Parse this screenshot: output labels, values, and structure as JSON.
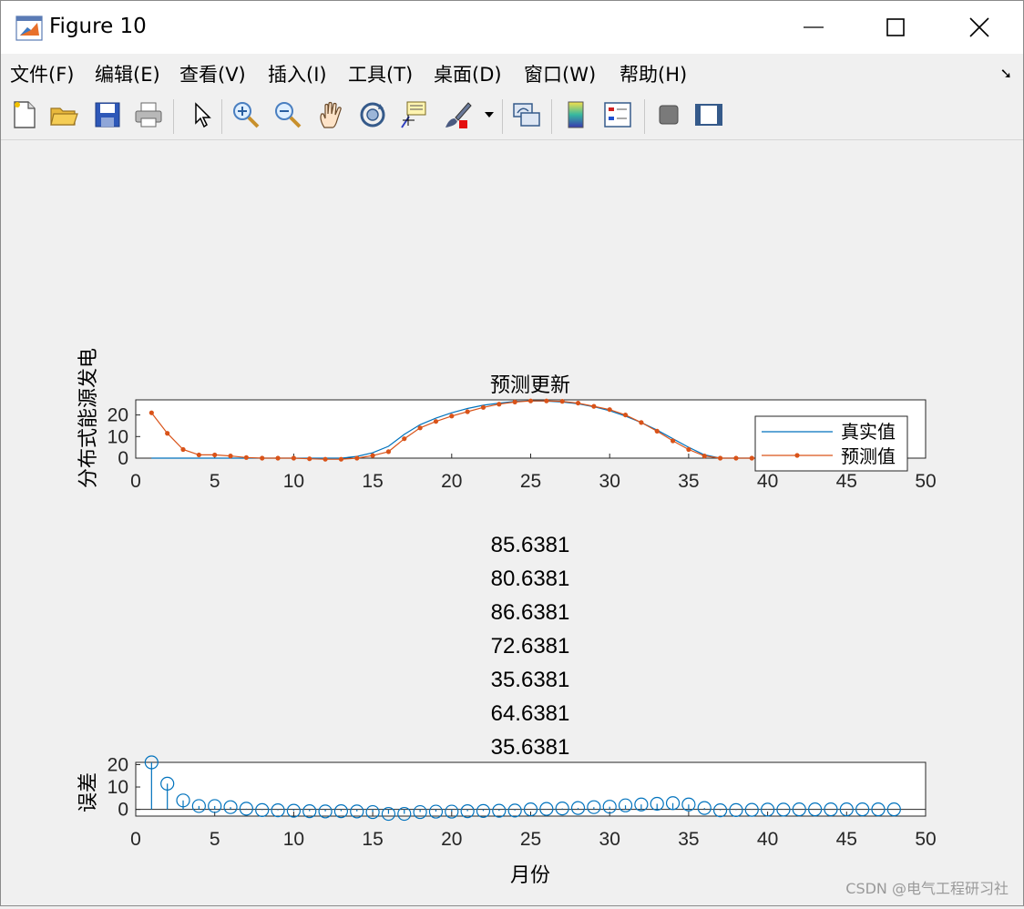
{
  "window": {
    "title": "Figure 10"
  },
  "menu": [
    "文件(F)",
    "编辑(E)",
    "查看(V)",
    "插入(I)",
    "工具(T)",
    "桌面(D)",
    "窗口(W)",
    "帮助(H)"
  ],
  "toolbar": [
    "new-figure-icon",
    "open-icon",
    "save-icon",
    "print-icon",
    "pointer-icon",
    "zoom-in-icon",
    "zoom-out-icon",
    "pan-icon",
    "rotate-icon",
    "data-cursor-icon",
    "brush-icon",
    "brush-dropdown-icon",
    "link-icon",
    "colorbar-icon",
    "legend-icon",
    "hide-plot-tools-icon",
    "show-plot-tools-icon"
  ],
  "colors": {
    "series_true": "#0072BD",
    "series_pred": "#D95319",
    "stem": "#0072BD"
  },
  "watermark": "CSDN @电气工程研习社",
  "numbers_text": [
    "85.6381",
    "80.6381",
    "86.6381",
    "72.6381",
    "35.6381",
    "64.6381",
    "35.6381"
  ],
  "chart_data": [
    {
      "type": "line",
      "title": "预测更新",
      "ylabel": "分布式能源发电",
      "xlabel": "",
      "xlim": [
        0,
        50
      ],
      "ylim": [
        0,
        27
      ],
      "xticks": [
        0,
        5,
        10,
        15,
        20,
        25,
        30,
        35,
        40,
        45,
        50
      ],
      "yticks": [
        0,
        10,
        20
      ],
      "legend": "right",
      "x": [
        1,
        2,
        3,
        4,
        5,
        6,
        7,
        8,
        9,
        10,
        11,
        12,
        13,
        14,
        15,
        16,
        17,
        18,
        19,
        20,
        21,
        22,
        23,
        24,
        25,
        26,
        27,
        28,
        29,
        30,
        31,
        32,
        33,
        34,
        35,
        36,
        37,
        38,
        39,
        40,
        41,
        42,
        43,
        44,
        45,
        46,
        47,
        48
      ],
      "series": [
        {
          "name": "真实值",
          "marker": "none",
          "values": [
            0,
            0,
            0,
            0,
            0,
            0,
            0,
            0,
            0,
            0,
            0,
            0,
            0,
            0.8,
            2.5,
            5.5,
            11,
            15.5,
            18.5,
            21,
            23,
            24.5,
            25.5,
            26.3,
            26.5,
            26.4,
            26,
            25.2,
            23.8,
            22,
            19.5,
            16.5,
            13,
            9,
            5,
            1.5,
            0,
            0,
            0,
            0,
            0,
            0,
            0,
            0,
            0,
            0,
            0,
            0
          ]
        },
        {
          "name": "预测值",
          "marker": "dot",
          "values": [
            21,
            11.5,
            4,
            1.5,
            1.5,
            1,
            0.3,
            0,
            0,
            0,
            -0.3,
            -0.5,
            -0.5,
            0,
            1.2,
            3,
            9,
            14,
            17,
            19.5,
            21.5,
            23.5,
            25,
            26,
            26.5,
            26.5,
            26.3,
            25.5,
            24,
            22.5,
            20,
            16.5,
            12.5,
            8,
            4,
            1,
            0,
            0,
            0,
            0,
            0,
            0,
            0,
            0,
            0,
            0,
            0,
            0
          ]
        }
      ]
    },
    {
      "type": "scatter",
      "title": "",
      "ylabel": "误差",
      "xlabel": "月份",
      "xlim": [
        0,
        50
      ],
      "ylim": [
        -3,
        21
      ],
      "xticks": [
        0,
        5,
        10,
        15,
        20,
        25,
        30,
        35,
        40,
        45,
        50
      ],
      "yticks": [
        0,
        10,
        20
      ],
      "x": [
        1,
        2,
        3,
        4,
        5,
        6,
        7,
        8,
        9,
        10,
        11,
        12,
        13,
        14,
        15,
        16,
        17,
        18,
        19,
        20,
        21,
        22,
        23,
        24,
        25,
        26,
        27,
        28,
        29,
        30,
        31,
        32,
        33,
        34,
        35,
        36,
        37,
        38,
        39,
        40,
        41,
        42,
        43,
        44,
        45,
        46,
        47,
        48
      ],
      "values": [
        21,
        11.5,
        4,
        1.5,
        1.5,
        1,
        0.3,
        -0.3,
        -0.4,
        -0.6,
        -0.8,
        -0.9,
        -0.8,
        -0.9,
        -1.2,
        -2,
        -2,
        -1.2,
        -1,
        -1,
        -0.8,
        -0.7,
        -0.6,
        -0.5,
        0,
        0.2,
        0.4,
        0.6,
        1,
        1.2,
        1.8,
        2.2,
        2.5,
        2.8,
        2.2,
        0.6,
        -0.4,
        -0.3,
        -0.2,
        -0.1,
        -0.1,
        0,
        0,
        0,
        0,
        0,
        0,
        0
      ]
    }
  ]
}
